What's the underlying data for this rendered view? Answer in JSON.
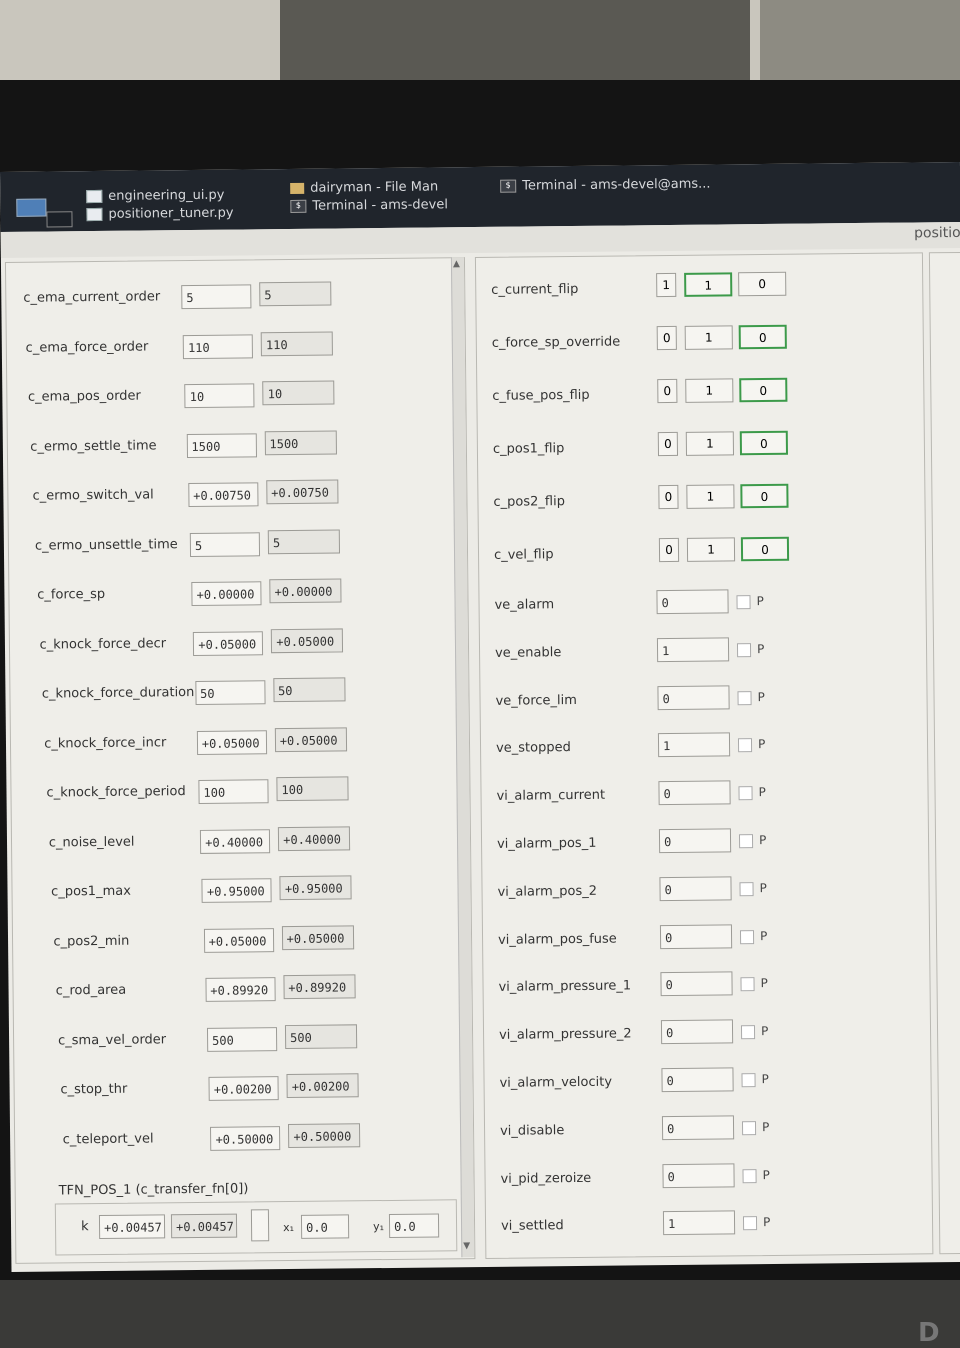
{
  "taskbar": {
    "items": [
      {
        "label": "engineering_ui.py",
        "icon": "doc-icon"
      },
      {
        "label": "positioner_tuner.py",
        "icon": "doc-icon"
      },
      {
        "label": "dairyman - File Man",
        "icon": "folder-icon"
      },
      {
        "label": "Terminal - ams-devel",
        "icon": "terminal-icon"
      },
      {
        "label": "Terminal - ams-devel@ams...",
        "icon": "terminal-icon"
      }
    ]
  },
  "window": {
    "title_fragment": "positio"
  },
  "left_params": [
    {
      "label": "c_ema_current_order",
      "current": "5",
      "new": "5"
    },
    {
      "label": "c_ema_force_order",
      "current": "110",
      "new": "110"
    },
    {
      "label": "c_ema_pos_order",
      "current": "10",
      "new": "10"
    },
    {
      "label": "c_ermo_settle_time",
      "current": "1500",
      "new": "1500"
    },
    {
      "label": "c_ermo_switch_val",
      "current": "+0.00750",
      "new": "+0.00750"
    },
    {
      "label": "c_ermo_unsettle_time",
      "current": "5",
      "new": "5"
    },
    {
      "label": "c_force_sp",
      "current": "+0.00000",
      "new": "+0.00000"
    },
    {
      "label": "c_knock_force_decr",
      "current": "+0.05000",
      "new": "+0.05000"
    },
    {
      "label": "c_knock_force_duration",
      "current": "50",
      "new": "50"
    },
    {
      "label": "c_knock_force_incr",
      "current": "+0.05000",
      "new": "+0.05000"
    },
    {
      "label": "c_knock_force_period",
      "current": "100",
      "new": "100"
    },
    {
      "label": "c_noise_level",
      "current": "+0.40000",
      "new": "+0.40000"
    },
    {
      "label": "c_pos1_max",
      "current": "+0.95000",
      "new": "+0.95000"
    },
    {
      "label": "c_pos2_min",
      "current": "+0.05000",
      "new": "+0.05000"
    },
    {
      "label": "c_rod_area",
      "current": "+0.89920",
      "new": "+0.89920"
    },
    {
      "label": "c_sma_vel_order",
      "current": "500",
      "new": "500"
    },
    {
      "label": "c_stop_thr",
      "current": "+0.00200",
      "new": "+0.00200"
    },
    {
      "label": "c_teleport_vel",
      "current": "+0.50000",
      "new": "+0.50000"
    }
  ],
  "tfn": {
    "title": "TFN_POS_1 (c_transfer_fn[0])",
    "k_label": "k",
    "k_current": "+0.00457",
    "k_new": "+0.00457",
    "x_label": "x₁",
    "x_value": "0.0",
    "y_label": "y₁",
    "y_value": "0.0"
  },
  "flip_params": [
    {
      "label": "c_current_flip",
      "value": "1",
      "opt1": "1",
      "opt0": "0",
      "selected": "1"
    },
    {
      "label": "c_force_sp_override",
      "value": "0",
      "opt1": "1",
      "opt0": "0",
      "selected": "0"
    },
    {
      "label": "c_fuse_pos_flip",
      "value": "0",
      "opt1": "1",
      "opt0": "0",
      "selected": "0"
    },
    {
      "label": "c_pos1_flip",
      "value": "0",
      "opt1": "1",
      "opt0": "0",
      "selected": "0"
    },
    {
      "label": "c_pos2_flip",
      "value": "0",
      "opt1": "1",
      "opt0": "0",
      "selected": "0"
    },
    {
      "label": "c_vel_flip",
      "value": "0",
      "opt1": "1",
      "opt0": "0",
      "selected": "0"
    }
  ],
  "var_params": [
    {
      "label": "ve_alarm",
      "value": "0",
      "p": "P"
    },
    {
      "label": "ve_enable",
      "value": "1",
      "p": "P"
    },
    {
      "label": "ve_force_lim",
      "value": "0",
      "p": "P"
    },
    {
      "label": "ve_stopped",
      "value": "1",
      "p": "P"
    },
    {
      "label": "vi_alarm_current",
      "value": "0",
      "p": "P"
    },
    {
      "label": "vi_alarm_pos_1",
      "value": "0",
      "p": "P"
    },
    {
      "label": "vi_alarm_pos_2",
      "value": "0",
      "p": "P"
    },
    {
      "label": "vi_alarm_pos_fuse",
      "value": "0",
      "p": "P"
    },
    {
      "label": "vi_alarm_pressure_1",
      "value": "0",
      "p": "P"
    },
    {
      "label": "vi_alarm_pressure_2",
      "value": "0",
      "p": "P"
    },
    {
      "label": "vi_alarm_velocity",
      "value": "0",
      "p": "P"
    },
    {
      "label": "vi_disable",
      "value": "0",
      "p": "P"
    },
    {
      "label": "vi_pid_zeroize",
      "value": "0",
      "p": "P"
    },
    {
      "label": "vi_settled",
      "value": "1",
      "p": "P"
    }
  ],
  "colors": {
    "selected_border": "#3c9a4a",
    "taskbar": "#20252c"
  }
}
